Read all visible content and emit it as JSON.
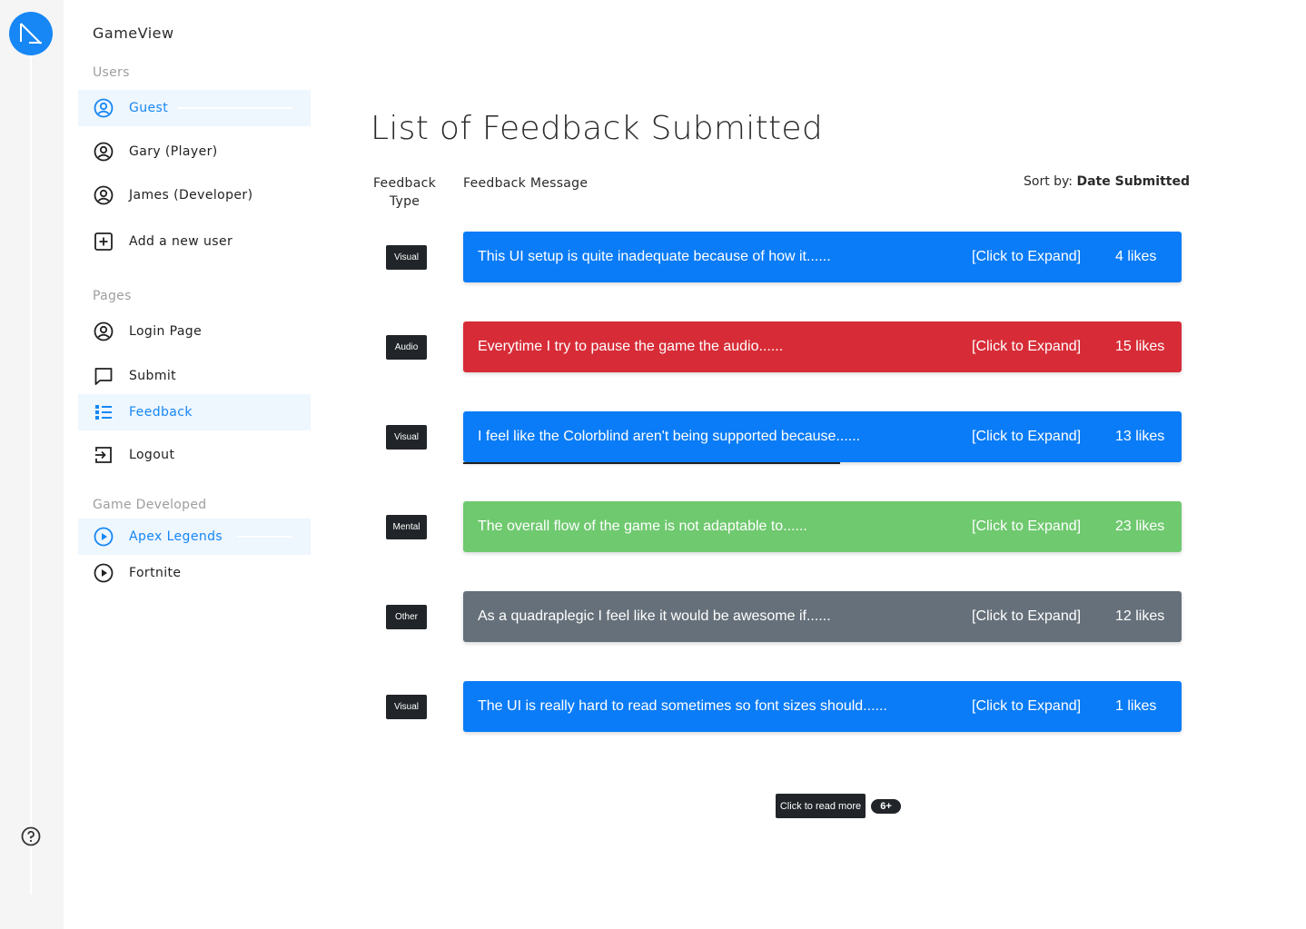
{
  "app": {
    "title": "GameView"
  },
  "sidebar": {
    "sections": {
      "users": "Users",
      "pages": "Pages",
      "games": "Game Developed"
    },
    "users": [
      {
        "label": "Guest",
        "icon": "user-circle-icon",
        "active": true
      },
      {
        "label": "Gary (Player)",
        "icon": "user-circle-icon"
      },
      {
        "label": "James (Developer)",
        "icon": "user-circle-icon"
      },
      {
        "label": "Add a new user",
        "icon": "plus-square-icon"
      }
    ],
    "pages": [
      {
        "label": "Login Page",
        "icon": "user-circle-icon"
      },
      {
        "label": "Submit",
        "icon": "chat-bubble-icon"
      },
      {
        "label": "Feedback",
        "icon": "list-icon",
        "active": true
      },
      {
        "label": "Logout",
        "icon": "logout-icon"
      }
    ],
    "games": [
      {
        "label": "Apex Legends",
        "icon": "play-circle-icon",
        "active": true
      },
      {
        "label": "Fortnite",
        "icon": "play-circle-icon"
      }
    ]
  },
  "main": {
    "title": "List of Feedback Submitted",
    "columns": {
      "type": "Feedback Type",
      "message": "Feedback Message"
    },
    "sort": {
      "label": "Sort by:",
      "value": "Date Submitted"
    },
    "expand_label": "[Click to Expand]",
    "feedback": [
      {
        "type": "Visual",
        "message": "This UI setup is quite inadequate because of how it......",
        "likes": "4 likes",
        "color": "#0a7cf7"
      },
      {
        "type": "Audio",
        "message": "Everytime I try to pause the game the audio......",
        "likes": "15 likes",
        "color": "#d72c37"
      },
      {
        "type": "Visual",
        "message": "I feel like the Colorblind aren't being supported because......",
        "likes": "13 likes",
        "color": "#0a7cf7"
      },
      {
        "type": "Mental",
        "message": "The overall flow of the game is not adaptable to......",
        "likes": "23 likes",
        "color": "#6fc96f"
      },
      {
        "type": "Other",
        "message": "As a quadraplegic I feel like it would be awesome if......",
        "likes": "12 likes",
        "color": "#66707a"
      },
      {
        "type": "Visual",
        "message": "The UI is really hard to read sometimes so font sizes should......",
        "likes": "1 likes",
        "color": "#0a7cf7"
      }
    ],
    "read_more": {
      "label": "Click to read more",
      "count": "6+"
    }
  },
  "colors": {
    "accent": "#1687f5",
    "active_bg": "#eef6fe"
  }
}
